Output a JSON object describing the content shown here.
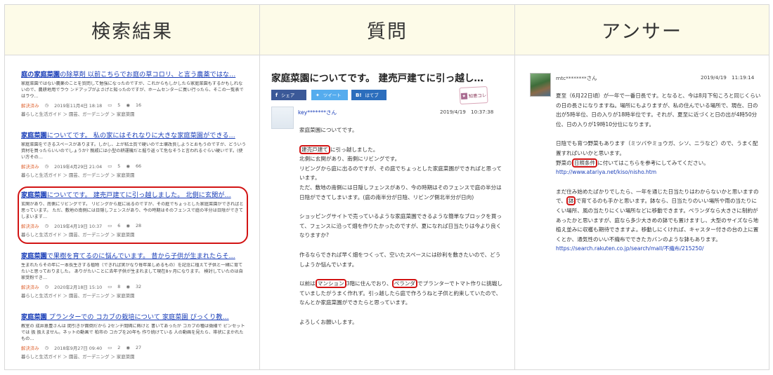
{
  "columns": {
    "search": "検索結果",
    "question": "質問",
    "answer": "アンサー"
  },
  "results": [
    {
      "title_bold": "庭の家庭菜園",
      "title_rest": "の除草剤 以前こちらでお庭の草コロリ、と言う農薬ではな…",
      "snippet": "家庭菜園ではない農薬のことを質問して勉強になったのですが、これからもしかしたら家庭菜園もするかもしれないので、農耕地用でラウ ンドアップがよさげと知ったのですが、ホームセンターに買い行ったら、そこの一覧表ではラウ…",
      "status": "解決済み",
      "date": "2019年11月4日 18:18",
      "answers": "5",
      "views": "16",
      "category": "暮らしと生活ガイド ＞ 園芸、ガーデニング ＞ 家庭菜園"
    },
    {
      "title_bold": "家庭菜園",
      "title_rest": "についてです。 私の家にはそれなりに大きな家庭菜園ができる…",
      "snippet": "家庭菜園をできるスペースがあります。しかし、上が粘土質で硬いので土壌改良しようとおもうのですが、どういう資材を買ったらいいのでしょうか? 親戚には小型の耕運機だと掘り返って危なそうと言われるぐらい硬いです。(使い方その…",
      "status": "解決済み",
      "date": "2019年4月29日 21:04",
      "answers": "5",
      "views": "66",
      "category": "暮らしと生活ガイド ＞ 園芸、ガーデニング ＞ 家庭菜園"
    },
    {
      "title_bold": "家庭菜園",
      "title_rest": "についてです。 建売戸建てに引っ越しました。 北側に玄関が…",
      "snippet": "玄関があり、南側にリビングです。 リビングから庭に出るのですが、その庭でちょっとした家庭菜園ができればと思っています。 ただ、敷地の南側には日隠しフェンスがあり、今の時期はそのフェンスで庭の半分は日陰ができてしまいます…",
      "status": "解決済み",
      "date": "2019年4月19日 10:37",
      "answers": "6",
      "views": "28",
      "category": "暮らしと生活ガイド ＞ 園芸、ガーデニング ＞ 家庭菜園"
    },
    {
      "title_bold": "家庭菜園",
      "title_rest": "で果樹を育てるのに悩んでいます。 昔から子供が生まれたらそ…",
      "snippet": "生まれたらその年に一本長生きする植物（できれば実がなり毎年楽しめるもの）を記念に植えて子供と一緒に育てたいと思っておりました。 ありがたいことに去年子供が生まれまして現在8ヶ月になります。 検討していたのは自家受粉でき…",
      "status": "解決済み",
      "date": "2020年2月18日 15:10",
      "answers": "8",
      "views": "32",
      "category": "暮らしと生活ガイド ＞ 園芸、ガーデニング ＞ 家庭菜園"
    },
    {
      "title_bold": "家庭菜園",
      "title_rest": " プランターでの コカブの栽培について 家庭菜園 ぴっくり教…",
      "snippet": "教室の 成井恵豊さんは 間引きが面倒だから 2センチ間隔に蒔けと 書いてあったが コカブの種は微細で ピンセットでは 扱 扱えません。ネットの動画で 柏市の コカブを20年も 作り続けている 人の動画を見たら、帯状にまかれた もの…",
      "status": "解決済み",
      "date": "2018年9月27日 09:40",
      "answers": "2",
      "views": "27",
      "category": "暮らしと生活ガイド ＞ 園芸、ガーデニング ＞ 家庭菜園"
    }
  ],
  "question": {
    "title": "家庭菜園についてです。 建売戸建てに引っ越し…",
    "share_fb": "シェア",
    "share_tw": "ツイート",
    "share_hb": "はてブ",
    "stamp": "知恵コレ",
    "user": "key*******さん",
    "date": "2019/4/19　10:37:38",
    "l1": "家庭菜園についてです。",
    "l2a": "建売戸建て",
    "l2b": "に引っ越しました。",
    "l3": "北側に玄関があり、南側にリビングです。",
    "l4": "リビングから庭に出るのですが、その庭でちょっとした家庭菜園ができればと思っています。",
    "l5": "ただ、敷地の南側には日隠しフェンスがあり、今の時期はそのフェンスで庭の半分は日陰ができてしまいます。(庭の南半分が日陰、リビング側北半分が日向)",
    "l6": "ショッピングサイトで売っているような家庭菜園できるような簡単なブロックを買って、フェンスに沿って畑を作りたかったのですが、夏になれば日当たりは今より良くなりますか?",
    "l7": "作るならできれば早く畑をつくって、空いたスペースには砂利を敷きたいので、どうしようか悩んでいます。",
    "l8a": "以前は",
    "l8b": "マンション",
    "l8c": "3階に住んでおり、",
    "l8d": "ベランダ",
    "l8e": "でプランターでトマト作りに挑戦していましたがうまく作れず。引っ越したら庭で作ろうねと子供と約束していたので、なんとか家庭菜園ができたらと思っています。",
    "l9": "よろしくお願いします。"
  },
  "answer": {
    "user": "mtc********さん",
    "date": "2019/4/19　11:19:14",
    "p1": "夏至（6月22日頃）が一年で一番日長です。となると、今は8月下旬ころと同じくらいの日の長さになりますね。場所にもよりますが、私の住んでいる場所で、現在、日の出が5時半位、日の入りが18時半位です。それが、夏至に近づくと日の出が4時50分位、日の入りが19時10分位になります。",
    "p2a": "日陰でも育つ野菜もあります（ミツバやミョウガ、シソ、ニラなど）ので、うまく配置すればいいかと思います。",
    "p2b": "野菜の",
    "p2c": "日照条件",
    "p2d": "に付いてはこちらを参考にしてみてください。",
    "url1": "http://www.atariya.net/kiso/nisho.htm",
    "p3a": "まだ住み始めたばかりでしたら、一年を通じた日当たりはわからないかと思いますので、",
    "p3b": "鉢",
    "p3c": "で育てるのも手かと思います。鉢なら、日当たりのいい場所や雨の当たりにくい場所、風の当たりにくい場所などに移動できます。ベランダなら大きさに制約があったかと思いますが、庭なら多少大きめの鉢でも置けますし、大型のサイズなら地植え並みに収穫も期待できますよ。移動しにくければ、キャスター付きの台の上に置くとか、通気性のいい不織布でできたカバンのような鉢もあります。",
    "url2": "https://search.rakuten.co.jp/search/mall/不織布/215250/"
  }
}
